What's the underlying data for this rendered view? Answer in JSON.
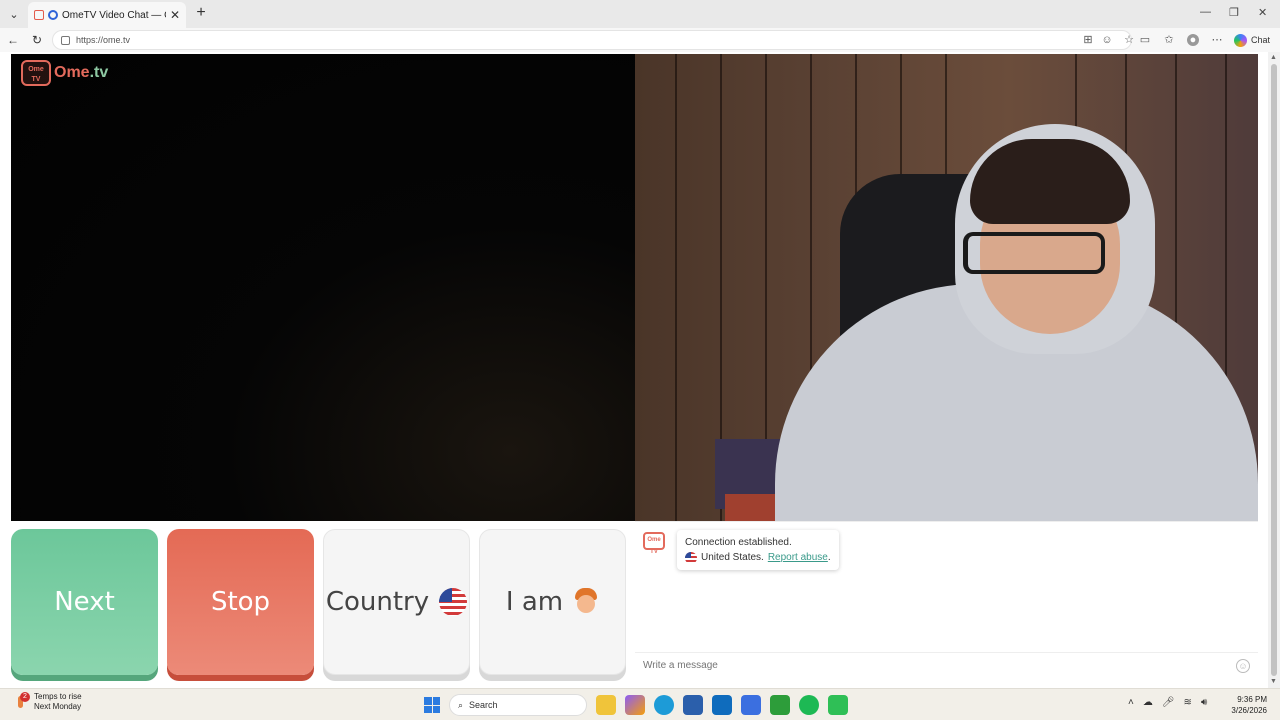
{
  "browser": {
    "tab_title": "OmeTV Video Chat — Omegle",
    "new_tab": "+",
    "close_tab": "✕",
    "url": "https://ome.tv",
    "chat_label": "Chat"
  },
  "site": {
    "logo_icon_text": "Ome TV",
    "logo_text_1": "Ome",
    "logo_text_2": ".tv"
  },
  "controls": {
    "next_label": "Next",
    "stop_label": "Stop",
    "country_label": "Country",
    "iam_label": "I am"
  },
  "chat": {
    "system_line1": "Connection established.",
    "country_name": "United States.",
    "report_link": "Report abuse",
    "report_suffix": ".",
    "message_placeholder": "Write a message"
  },
  "taskbar": {
    "weather_badge": "2",
    "weather_line1": "Temps to rise",
    "weather_line2": "Next Monday",
    "search_placeholder": "Search",
    "time": "9:36 PM",
    "date": "3/26/2026"
  },
  "icons": [
    "tab-list-icon",
    "omegle-favicon",
    "recording-icon",
    "back-icon",
    "refresh-icon",
    "lock-icon",
    "split-screen-icon",
    "reader-icon",
    "favorite-icon",
    "video-icon",
    "favorites-icon",
    "profile-icon",
    "more-icon",
    "copilot-icon",
    "flag-us-icon",
    "boy-emoji-icon",
    "emoji-icon",
    "windows-start-icon",
    "search-icon"
  ],
  "colors": {
    "next": "#6cc79a",
    "stop": "#e46a55",
    "brand": "#e36a5c",
    "link": "#3a9a8a"
  }
}
